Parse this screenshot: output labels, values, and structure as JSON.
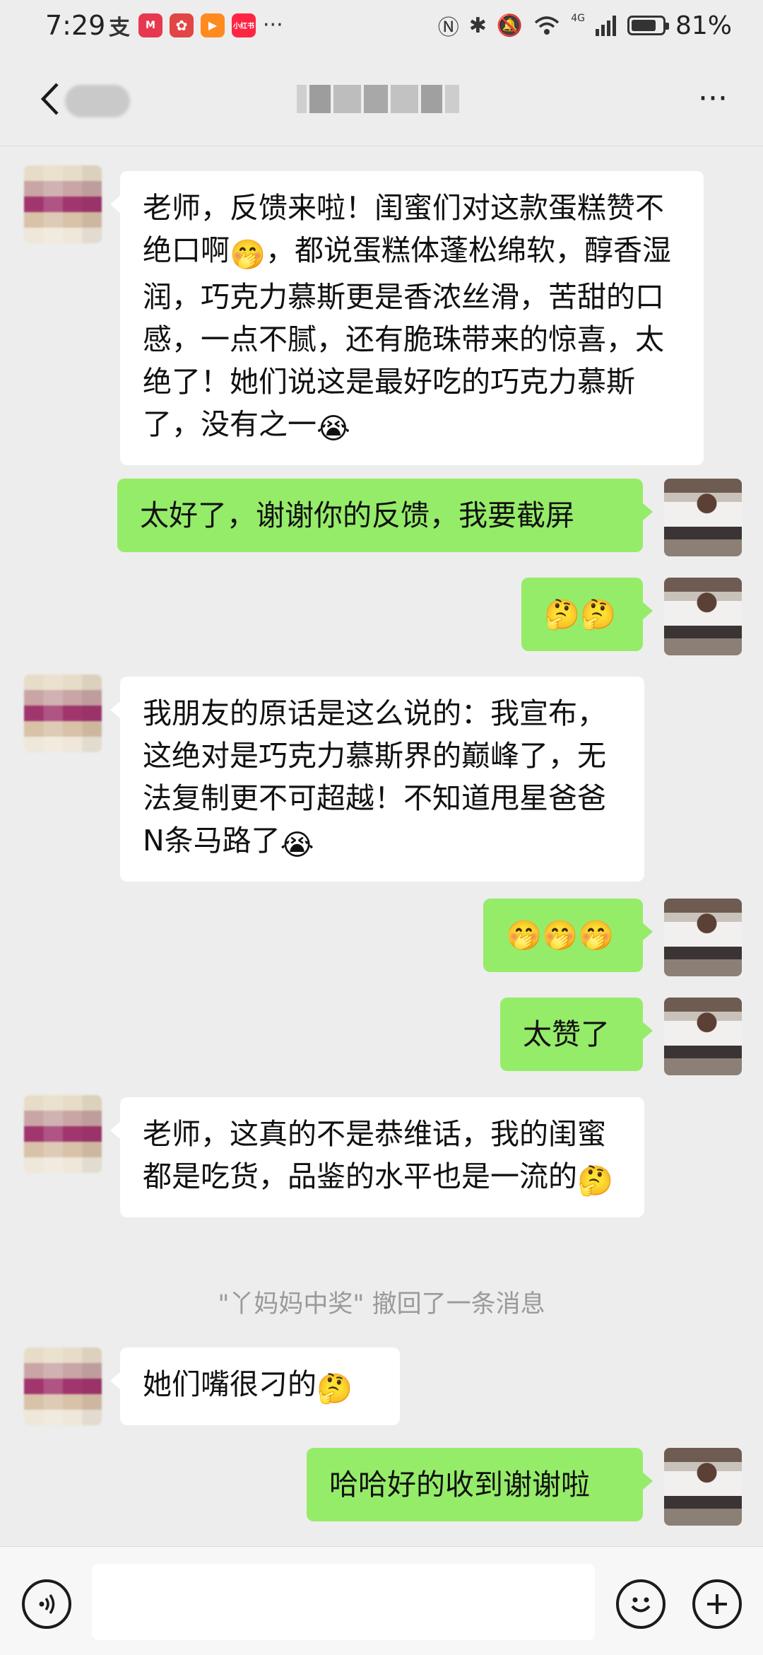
{
  "status_bar": {
    "time": "7:29",
    "battery_percent": "81%",
    "battery_level": 0.81,
    "apps": [
      {
        "name": "alipay-icon",
        "label": "支",
        "color": "#1677ff"
      },
      {
        "name": "metro-icon",
        "label": "M",
        "color": "#e8384f"
      },
      {
        "name": "flower-icon",
        "label": "✿",
        "color": "#e24545"
      },
      {
        "name": "video-icon",
        "label": "▶",
        "color": "#ff8a1f"
      },
      {
        "name": "xiaohongshu-icon",
        "label": "小红书",
        "color": "#ff2442"
      }
    ],
    "more_apps": "···",
    "network_label": "4G"
  },
  "header": {
    "more_label": "···"
  },
  "recall_notice": "\"丫妈妈中奖\" 撤回了一条消息",
  "colors": {
    "outgoing_bubble": "#95ec69",
    "incoming_bubble": "#ffffff",
    "background": "#ededed"
  },
  "messages": [
    {
      "id": "m1",
      "side": "in",
      "text": "老师，反馈来啦！闺蜜们对这款蛋糕赞不绝口啊",
      "emoji1": "🤭",
      "text2": "，都说蛋糕体蓬松绵软，醇香湿润，巧克力慕斯更是香浓丝滑，苦甜的口感，一点不腻，还有脆珠带来的惊喜，太绝了！她们说这是最好吃的巧克力慕斯了，没有之一",
      "emoji2": "😭"
    },
    {
      "id": "m2",
      "side": "out",
      "text": "太好了，谢谢你的反馈，我要截屏"
    },
    {
      "id": "m3",
      "side": "out",
      "text": "🤔🤔"
    },
    {
      "id": "m4",
      "side": "in",
      "text": "我朋友的原话是这么说的：我宣布，这绝对是巧克力慕斯界的巅峰了，无法复制更不可超越！不知道甩星爸爸N条马路了",
      "emoji1": "😭"
    },
    {
      "id": "m5",
      "side": "out",
      "text": "🤭🤭🤭"
    },
    {
      "id": "m6",
      "side": "out",
      "text": "太赞了"
    },
    {
      "id": "m7",
      "side": "in",
      "text": "老师，这真的不是恭维话，我的闺蜜都是吃货，品鉴的水平也是一流的",
      "emoji1": "🤔"
    },
    {
      "id": "m8",
      "side": "in",
      "text": "她们嘴很刁的",
      "emoji1": "🤔"
    },
    {
      "id": "m9",
      "side": "out",
      "text": "哈哈好的收到谢谢啦"
    }
  ]
}
